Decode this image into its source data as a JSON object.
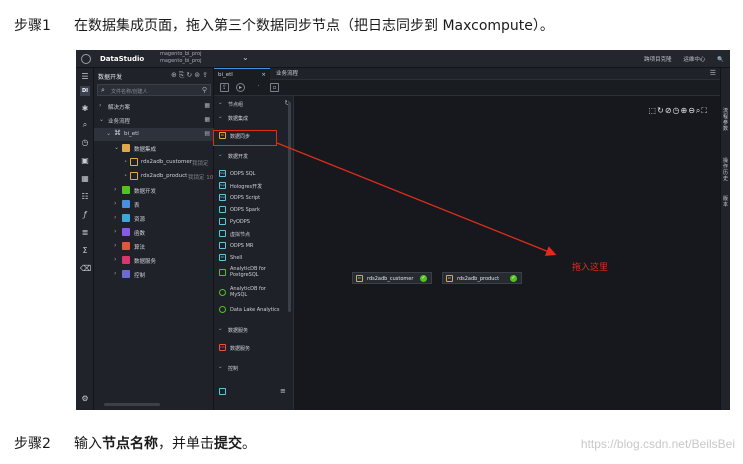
{
  "step1": {
    "num": "步骤1",
    "text": "在数据集成页面，拖入第三个数据同步节点（把日志同步到 Maxcompute）。"
  },
  "step2": {
    "num": "步骤2",
    "pre": "输入",
    "b1": "节点名称",
    "mid": "，并单击",
    "b2": "提交",
    "post": "。"
  },
  "watermark": "https://blog.csdn.net/BeilsBei",
  "annotation": "拖入这里",
  "app": {
    "brand": "DataStudio",
    "workspace_line1": "magento_bi_proj",
    "workspace_line2": "magento_bi_proj",
    "topbar_right": [
      "跨项目克隆",
      "运维中心"
    ],
    "iconbar_active": "DI",
    "tree": {
      "title": "数据开发",
      "search_placeholder": "文件名称/创建人",
      "rows": [
        {
          "label": "解决方案"
        },
        {
          "label": "业务流程"
        },
        {
          "label": "bi_etl"
        },
        {
          "label": "数据集成"
        },
        {
          "label": "rds2adb_customer",
          "note": "我锁定"
        },
        {
          "label": "rds2adb_product",
          "note": "我锁定 10"
        },
        {
          "label": "数据开发"
        },
        {
          "label": "表"
        },
        {
          "label": "资源"
        },
        {
          "label": "函数"
        },
        {
          "label": "算法"
        },
        {
          "label": "数据服务"
        },
        {
          "label": "控制"
        }
      ]
    },
    "tabs": [
      {
        "label": "bi_etl"
      },
      {
        "label": "业务流程"
      }
    ],
    "palette": {
      "header": "节点组",
      "sections": [
        {
          "label": "数据集成"
        },
        {
          "label": "数据开发"
        },
        {
          "label": "数据服务"
        },
        {
          "label": "控制"
        }
      ],
      "items_integration": [
        "数据同步"
      ],
      "items_dev": [
        "ODPS SQL",
        "Hologres开发",
        "ODPS Script",
        "ODPS Spark",
        "PyODPS",
        "虚拟节点",
        "ODPS MR",
        "Shell",
        "AnalyticDB for PostgreSQL",
        "AnalyticDB for MySQL",
        "Data Lake Analytics"
      ],
      "items_service": [
        "数据服务"
      ],
      "icon_labels": {
        "di": "DI",
        "sql": "Sql",
        "shell": "Sh",
        "ds": "DS"
      }
    },
    "canvas_nodes": [
      {
        "label": "rds2adb_customer"
      },
      {
        "label": "rds2adb_product"
      }
    ],
    "rightbar": [
      "流程参数",
      "操作历史",
      "版本"
    ]
  }
}
